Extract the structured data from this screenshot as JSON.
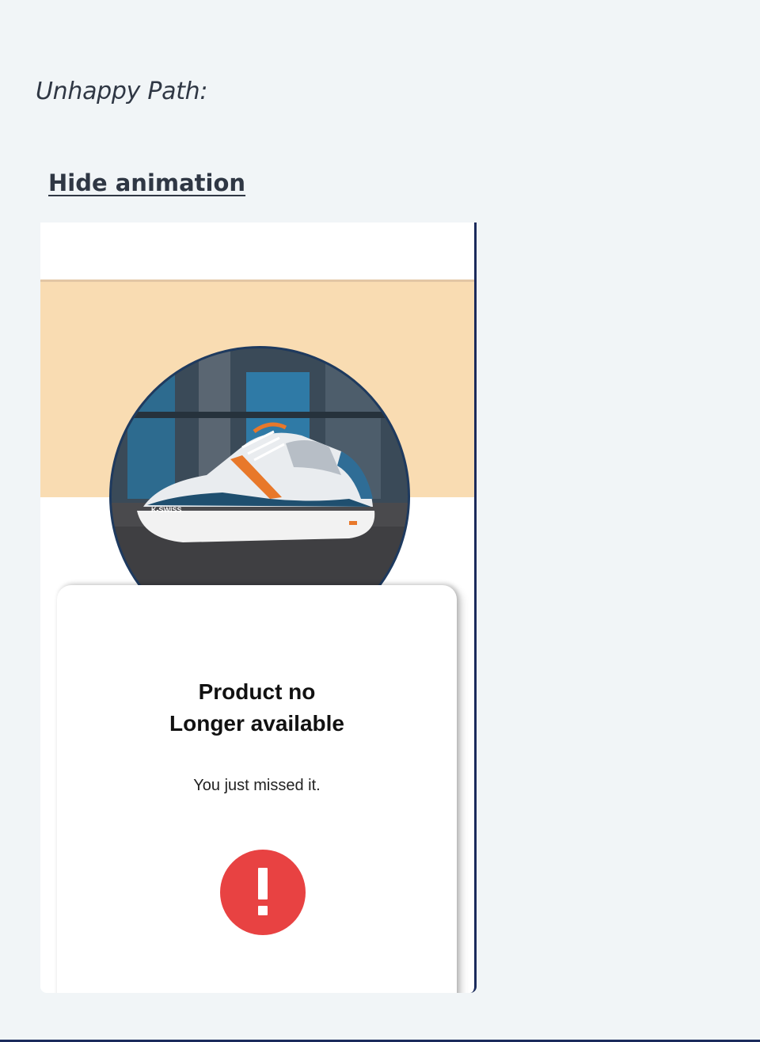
{
  "section": {
    "label": "Unhappy Path:"
  },
  "toggle": {
    "label": "Hide animation"
  },
  "screen": {
    "card": {
      "title": "Product no\nLonger available",
      "subtitle": "You just missed it."
    },
    "product_image": {
      "subject": "sneaker",
      "brand_text": "K-SWISS"
    },
    "alert_icon": {
      "name": "exclamation-icon",
      "color": "#e84242"
    }
  },
  "colors": {
    "page_background": "#f1f5f7",
    "band": "#f9dcb2",
    "text": "#2f3744"
  }
}
